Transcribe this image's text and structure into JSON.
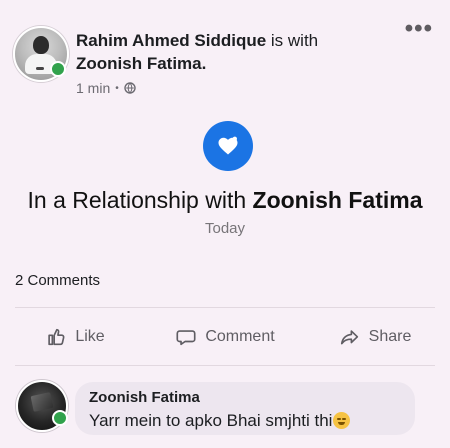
{
  "post": {
    "author": "Rahim Ahmed Siddique",
    "with_text": " is with",
    "tagged_user": "Zoonish Fatima.",
    "time": "1 min",
    "separator": "•",
    "privacy_icon": "globe-icon",
    "more_icon": "ellipsis-icon",
    "more_text": "•••"
  },
  "relationship": {
    "status_prefix": "In a Relationship with ",
    "partner": "Zoonish Fatima",
    "date": "Today",
    "icon": "heart-badge-icon",
    "badge_color": "#1b74e4"
  },
  "engagement": {
    "comments_count": "2 Comments"
  },
  "actions": [
    {
      "label": "Like",
      "icon": "like-icon"
    },
    {
      "label": "Comment",
      "icon": "comment-icon"
    },
    {
      "label": "Share",
      "icon": "share-icon"
    }
  ],
  "comment": {
    "author": "Zoonish Fatima",
    "text": "Yarr mein to apko Bhai smjhti thi",
    "emoji_icon": "smiling-face-icon"
  },
  "colors": {
    "background": "#f7eef6",
    "online": "#31a24c",
    "muted_text": "#6c6a71"
  }
}
